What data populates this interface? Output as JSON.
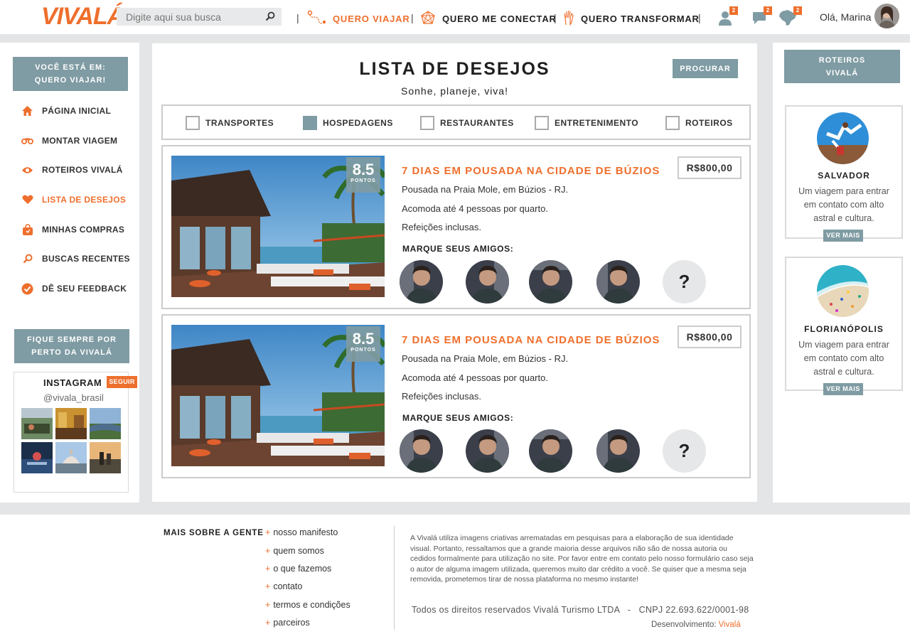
{
  "brand": {
    "logo_text": "VIVALÁ",
    "accent": "#ee6f2d",
    "slate": "#7f9ba3"
  },
  "header": {
    "search_placeholder": "Digite aqui sua busca",
    "nav": [
      {
        "label": "QUERO VIAJAR",
        "icon": "route-icon",
        "active": true
      },
      {
        "label": "QUERO ME CONECTAR",
        "icon": "network-icon",
        "active": false
      },
      {
        "label": "QUERO TRANSFORMAR",
        "icon": "hand-icon",
        "active": false
      }
    ],
    "separators": [
      "|",
      "|",
      "|",
      "|"
    ],
    "badges": {
      "profile": "2",
      "messages": "2",
      "map": "2"
    },
    "greeting": "Olá, Marina"
  },
  "sidebar": {
    "location_label": "VOCÊ ESTÁ EM:",
    "location_value": "QUERO VIAJAR!",
    "items": [
      {
        "label": "PÁGINA INICIAL",
        "icon": "home-icon"
      },
      {
        "label": "MONTAR VIAGEM",
        "icon": "binoculars-icon"
      },
      {
        "label": "ROTEIROS VIVALÁ",
        "icon": "eye-icon"
      },
      {
        "label": "LISTA DE DESEJOS",
        "icon": "heart-icon",
        "active": true
      },
      {
        "label": "MINHAS COMPRAS",
        "icon": "bag-icon"
      },
      {
        "label": "BUSCAS RECENTES",
        "icon": "search-icon"
      },
      {
        "label": "DÊ SEU FEEDBACK",
        "icon": "check-icon"
      }
    ],
    "stay_line1": "FIQUE SEMPRE POR",
    "stay_line2": "PERTO DA VIVALÁ",
    "instagram": {
      "title": "INSTAGRAM",
      "follow": "SEGUIR",
      "handle": "@vivala_brasil"
    }
  },
  "main": {
    "title": "LISTA DE DESEJOS",
    "subtitle": "Sonhe, planeje, viva!",
    "search_button": "PROCURAR",
    "filters": [
      {
        "label": "TRANSPORTES",
        "checked": false
      },
      {
        "label": "HOSPEDAGENS",
        "checked": true
      },
      {
        "label": "RESTAURANTES",
        "checked": false
      },
      {
        "label": "ENTRETENIMENTO",
        "checked": false
      },
      {
        "label": "ROTEIROS",
        "checked": false
      }
    ],
    "cards": [
      {
        "score": "8.5",
        "score_label": "PONTOS",
        "title": "7 DIAS EM POUSADA NA CIDADE DE BÚZIOS",
        "price": "R$800,00",
        "lines": [
          "Pousada na Praia Mole, em Búzios - RJ.",
          "Acomoda até 4 pessoas por quarto.",
          "Refeições inclusas."
        ],
        "friends_label": "MARQUE SEUS AMIGOS:",
        "more": "?"
      },
      {
        "score": "8.5",
        "score_label": "PONTOS",
        "title": "7 DIAS EM POUSADA NA CIDADE DE BÚZIOS",
        "price": "R$800,00",
        "lines": [
          "Pousada na Praia Mole, em Búzios - RJ.",
          "Acomoda até 4 pessoas por quarto.",
          "Refeições inclusas."
        ],
        "friends_label": "MARQUE SEUS AMIGOS:",
        "more": "?"
      }
    ]
  },
  "right": {
    "title_line1": "ROTEIROS",
    "title_line2": "VIVALÁ",
    "cards": [
      {
        "name": "SALVADOR",
        "desc": "Um viagem para entrar em contato com alto astral e cultura.",
        "button": "VER MAIS"
      },
      {
        "name": "FLORIANÓPOLIS",
        "desc": "Um viagem para entrar em contato com alto astral e cultura.",
        "button": "VER MAIS"
      }
    ]
  },
  "footer": {
    "title": "MAIS SOBRE A GENTE",
    "plus": "+",
    "links": [
      "nosso manifesto",
      "quem somos",
      "o que fazemos",
      "contato",
      "termos e condições",
      "parceiros"
    ],
    "disclaimer": "A Vivalá utiliza imagens criativas arrematadas em pesquisas para a elaboração de sua identidade visual. Portanto, ressaltamos que a grande maioria desse arquivos não são de nossa autoria ou cedidos formalmente para utilização no site. Por favor entre em contato pelo nosso formulário caso seja o autor de alguma imagem utilizada, queremos muito dar crédito a você. Se quiser que a mesma seja removida, prometemos tirar de nossa plataforma no mesmo instante!",
    "rights": "Todos os direitos reservados Vivalá Turismo LTDA   -   CNPJ 22.693.622/0001-98",
    "dev_label": "Desenvolvimento:",
    "dev_name": "Vivalá"
  }
}
